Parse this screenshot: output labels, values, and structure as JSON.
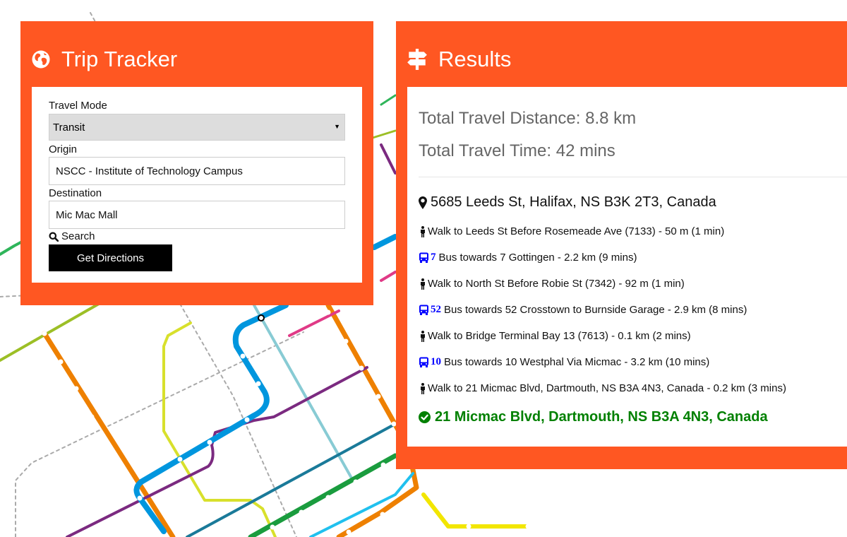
{
  "colors": {
    "panel": "#ff5722",
    "button": "#000000",
    "bus_route": "#0000ff",
    "destination": "#008000"
  },
  "trip_tracker": {
    "title": "Trip Tracker",
    "header_icon": "globe-icon",
    "travel_mode_label": "Travel Mode",
    "travel_mode_value": "Transit",
    "origin_label": "Origin",
    "origin_value": "NSCC - Institute of Technology Campus",
    "destination_label": "Destination",
    "destination_value": "Mic Mac Mall",
    "search_label": "Search",
    "button_label": "Get Directions"
  },
  "results": {
    "title": "Results",
    "header_icon": "signpost-icon",
    "total_distance": "Total Travel Distance: 8.8 km",
    "total_time": "Total Travel Time: 42 mins",
    "origin": "5685 Leeds St, Halifax, NS B3K 2T3, Canada",
    "steps": [
      {
        "type": "walk",
        "icon": "walking-person-icon",
        "text": "Walk to Leeds St Before Rosemeade Ave (7133) - 50 m (1 min)"
      },
      {
        "type": "bus",
        "icon": "bus-icon",
        "route": "7",
        "text": "Bus towards 7 Gottingen - 2.2 km (9 mins)"
      },
      {
        "type": "walk",
        "icon": "walking-person-icon",
        "text": "Walk to North St Before Robie St (7342) - 92 m (1 min)"
      },
      {
        "type": "bus",
        "icon": "bus-icon",
        "route": "52",
        "text": "Bus towards 52 Crosstown to Burnside Garage - 2.9 km (8 mins)"
      },
      {
        "type": "walk",
        "icon": "walking-person-icon",
        "text": "Walk to Bridge Terminal Bay 13 (7613) - 0.1 km (2 mins)"
      },
      {
        "type": "bus",
        "icon": "bus-icon",
        "route": "10",
        "text": "Bus towards 10 Westphal Via Micmac - 3.2 km (10 mins)"
      },
      {
        "type": "walk",
        "icon": "walking-person-icon",
        "text": "Walk to 21 Micmac Blvd, Dartmouth, NS B3A 4N3, Canada - 0.2 km (3 mins)"
      }
    ],
    "destination": "21 Micmac Blvd, Dartmouth, NS B3A 4N3, Canada"
  }
}
